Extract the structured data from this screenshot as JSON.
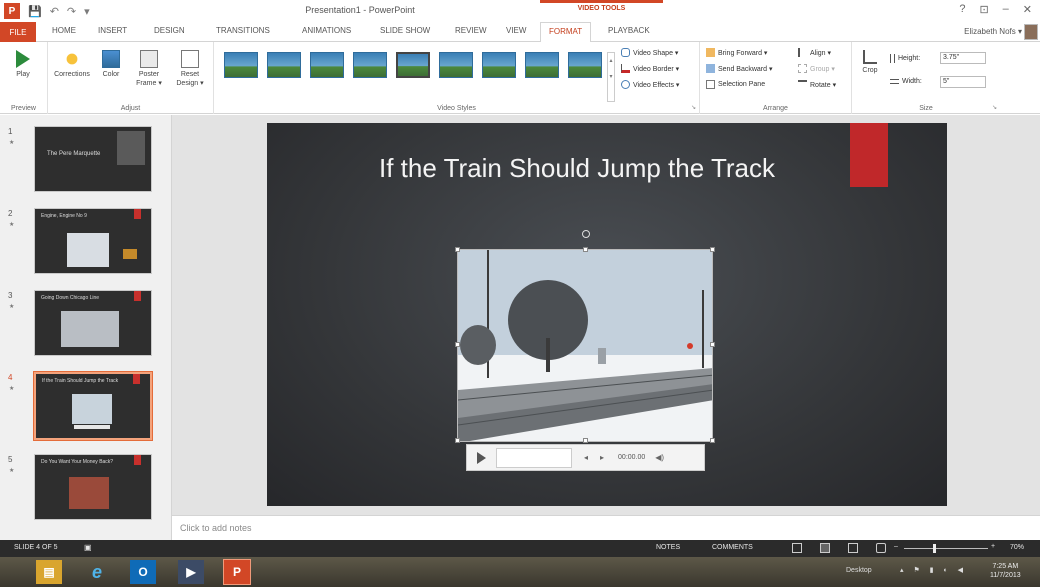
{
  "app": {
    "logo": "P",
    "title": "Presentation1 - PowerPoint",
    "contextual_group": "VIDEO TOOLS",
    "window_controls": {
      "help": "?",
      "restore_ribbon": "⊡",
      "minimize": "–",
      "close": "✕"
    },
    "quick_access": {
      "save": "💾",
      "undo": "↶",
      "redo": "↷",
      "customize": "▾"
    }
  },
  "tabs": [
    {
      "label": "FILE"
    },
    {
      "label": "HOME"
    },
    {
      "label": "INSERT"
    },
    {
      "label": "DESIGN"
    },
    {
      "label": "TRANSITIONS"
    },
    {
      "label": "ANIMATIONS"
    },
    {
      "label": "SLIDE SHOW"
    },
    {
      "label": "REVIEW"
    },
    {
      "label": "VIEW"
    },
    {
      "label": "FORMAT",
      "active": true
    },
    {
      "label": "PLAYBACK"
    }
  ],
  "user": {
    "name": "Elizabeth Nofs ▾"
  },
  "ribbon": {
    "preview": {
      "label": "Preview",
      "play": "Play"
    },
    "adjust": {
      "label": "Adjust",
      "corrections": "Corrections",
      "color": "Color",
      "poster_frame": "Poster Frame ▾",
      "reset_design": "Reset Design ▾"
    },
    "video_styles": {
      "label": "Video Styles",
      "video_shape": "Video Shape ▾",
      "video_border": "Video Border ▾",
      "video_effects": "Video Effects ▾"
    },
    "arrange": {
      "label": "Arrange",
      "bring_forward": "Bring Forward ▾",
      "send_backward": "Send Backward ▾",
      "selection_pane": "Selection Pane",
      "align": "Align ▾",
      "group": "Group ▾",
      "rotate": "Rotate ▾"
    },
    "size": {
      "label": "Size",
      "crop": "Crop",
      "height_label": "Height:",
      "height_value": "3.75\"",
      "width_label": "Width:",
      "width_value": "5\""
    }
  },
  "thumbnails": [
    {
      "number": "1",
      "title": "The Pere Marquette"
    },
    {
      "number": "2",
      "title": "Engine, Engine No 9"
    },
    {
      "number": "3",
      "title": "Going Down Chicago Line"
    },
    {
      "number": "4",
      "title": "If the Train Should Jump the Track",
      "selected": true
    },
    {
      "number": "5",
      "title": "Do You Want Your Money Back?"
    }
  ],
  "slide": {
    "title": "If the Train Should Jump the Track",
    "controls": {
      "time": "00:00.00",
      "back": "◂",
      "forward": "▸",
      "volume": "◀)"
    }
  },
  "notes": {
    "placeholder": "Click to add notes"
  },
  "status": {
    "slide_of": "SLIDE 4 OF 5",
    "notes": "NOTES",
    "comments": "COMMENTS",
    "zoom_minus": "–",
    "zoom_plus": "+",
    "zoom": "70%",
    "zoom_level": 0.36
  },
  "taskbar": {
    "desktop": "Desktop",
    "time": "7:25 AM",
    "date": "11/7/2013"
  },
  "colors": {
    "accent": "#d24726",
    "slide_bg": "#343639",
    "status_bg": "#2b2b2b"
  }
}
